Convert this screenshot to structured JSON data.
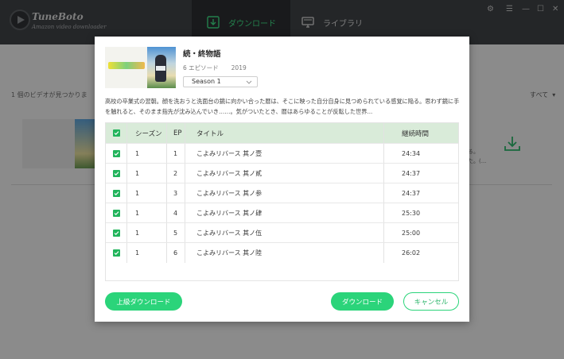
{
  "app": {
    "brand_name": "TuneBoto",
    "brand_sub": "Amazon video downloader",
    "tabs": [
      {
        "label": "ダウンロード",
        "icon": "download-icon",
        "active": true
      },
      {
        "label": "ライブラリ",
        "icon": "monitor-icon",
        "active": false
      }
    ],
    "window_controls": [
      "gear-icon",
      "menu-icon",
      "minimize-icon",
      "maximize-icon",
      "close-icon"
    ],
    "found_text": "1 個のビデオが見つかりま",
    "filter_label": "すべて",
    "bg_row_snippet_1": "る。",
    "bg_row_snippet_2": "た。(..."
  },
  "dialog": {
    "title": "続・終物語",
    "episodes_label": "6 エピソード",
    "year": "2019",
    "season_select": "Season 1",
    "description": "高校の卒業式の翌朝。顔を洗おうと洗面台の鏡に向かい合った暦は、そこに映った自分自身に見つめられている感覚に陥る。思わず鏡に手を触れると、そのまま指先が沈み込んでいき……。気がついたとき、暦はあらゆることが反転した世界...",
    "table": {
      "headers": {
        "season": "シーズン",
        "ep": "EP",
        "title": "タイトル",
        "duration": "継続時間"
      },
      "rows": [
        {
          "season": "1",
          "ep": "1",
          "title": "こよみリバース 其ノ壹",
          "duration": "24:34",
          "checked": true
        },
        {
          "season": "1",
          "ep": "2",
          "title": "こよみリバース 其ノ貳",
          "duration": "24:37",
          "checked": true
        },
        {
          "season": "1",
          "ep": "3",
          "title": "こよみリバース 其ノ参",
          "duration": "24:37",
          "checked": true
        },
        {
          "season": "1",
          "ep": "4",
          "title": "こよみリバース 其ノ肆",
          "duration": "25:30",
          "checked": true
        },
        {
          "season": "1",
          "ep": "5",
          "title": "こよみリバース 其ノ伍",
          "duration": "25:00",
          "checked": true
        },
        {
          "season": "1",
          "ep": "6",
          "title": "こよみリバース 其ノ陸",
          "duration": "26:02",
          "checked": true
        }
      ]
    },
    "buttons": {
      "advanced": "上級ダウンロード",
      "download": "ダウンロード",
      "cancel": "キャンセル"
    }
  },
  "colors": {
    "accent": "#2bd47a",
    "titlebar": "#3f4246",
    "table_header": "#d9ebd9"
  }
}
